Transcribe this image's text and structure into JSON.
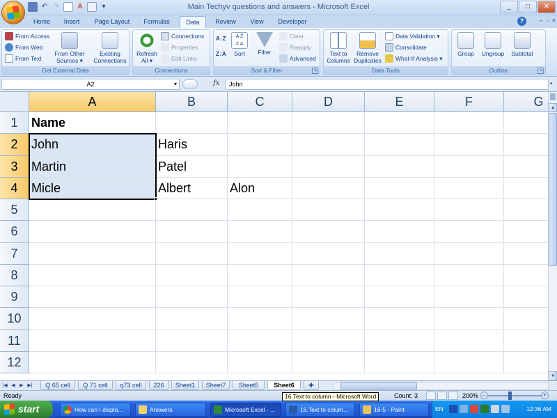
{
  "window": {
    "title": "Main Techyv questions and answers - Microsoft Excel",
    "controls": [
      "_",
      "□",
      "✕"
    ]
  },
  "quick_access": {
    "items": [
      "save-icon",
      "undo-icon",
      "redo-icon",
      "new-icon",
      "font-icon",
      "print-preview-icon",
      "customize-icon"
    ]
  },
  "ribbon_tabs": [
    "Home",
    "Insert",
    "Page Layout",
    "Formulas",
    "Data",
    "Review",
    "View",
    "Developer"
  ],
  "active_tab": "Data",
  "ribbon": {
    "get_external_data": {
      "label": "Get External Data",
      "from_access": "From Access",
      "from_web": "From Web",
      "from_text": "From Text",
      "from_other_sources": [
        "From Other",
        "Sources ▾"
      ],
      "existing_connections": [
        "Existing",
        "Connections"
      ]
    },
    "connections": {
      "label": "Connections",
      "refresh_all": [
        "Refresh",
        "All ▾"
      ],
      "connections": "Connections",
      "properties": "Properties",
      "edit_links": "Edit Links"
    },
    "sort_filter": {
      "label": "Sort & Filter",
      "sort": "Sort",
      "filter": "Filter",
      "clear": "Clear",
      "reapply": "Reapply",
      "advanced": "Advanced"
    },
    "data_tools": {
      "label": "Data Tools",
      "text_to_columns": [
        "Text to",
        "Columns"
      ],
      "remove_duplicates": [
        "Remove",
        "Duplicates"
      ],
      "data_validation": "Data Validation ▾",
      "consolidate": "Consolidate",
      "what_if": "What-If Analysis ▾"
    },
    "outline": {
      "label": "Outline",
      "group": "Group",
      "ungroup": "Ungroup",
      "subtotal": "Subtotal"
    }
  },
  "formula_bar": {
    "name_box": "A2",
    "fx": "fx",
    "content": "John"
  },
  "sheet": {
    "columns": [
      "A",
      "B",
      "C",
      "D",
      "E",
      "F",
      "G"
    ],
    "rows": [
      "1",
      "2",
      "3",
      "4",
      "5",
      "6",
      "7",
      "8",
      "9",
      "10",
      "11",
      "12"
    ],
    "cells": {
      "A1": "Name",
      "A2": "John",
      "A3": "Martin",
      "A4": "Micle",
      "B2": " Haris",
      "B3": "Patel",
      "B4": "Albert",
      "C4": "Alon"
    }
  },
  "sheet_tabs": [
    "Q 65 cell",
    "Q 71 cell",
    "q73 cell",
    "226",
    "Sheet1",
    "Sheet7",
    "Sheet5",
    "Sheet6"
  ],
  "active_sheet": "Sheet6",
  "status": {
    "ready": "Ready",
    "count": "Count: 3",
    "zoom": "200%"
  },
  "tooltip": "16.Text to column - Microsoft Word",
  "taskbar": {
    "start": "start",
    "items": [
      "How can I displa...",
      "Answers",
      "Microsoft Excel - ...",
      "16.Text to colum...",
      "16-5 - Paint"
    ],
    "language": "EN",
    "clock": "12:36 AM"
  },
  "colors": {
    "ribbon_bg": "#dde9f8",
    "selection_header": "#f8c96a",
    "range_fill": "#dbe6f4",
    "taskbar": "#245edb",
    "start_button": "#3b913b"
  }
}
